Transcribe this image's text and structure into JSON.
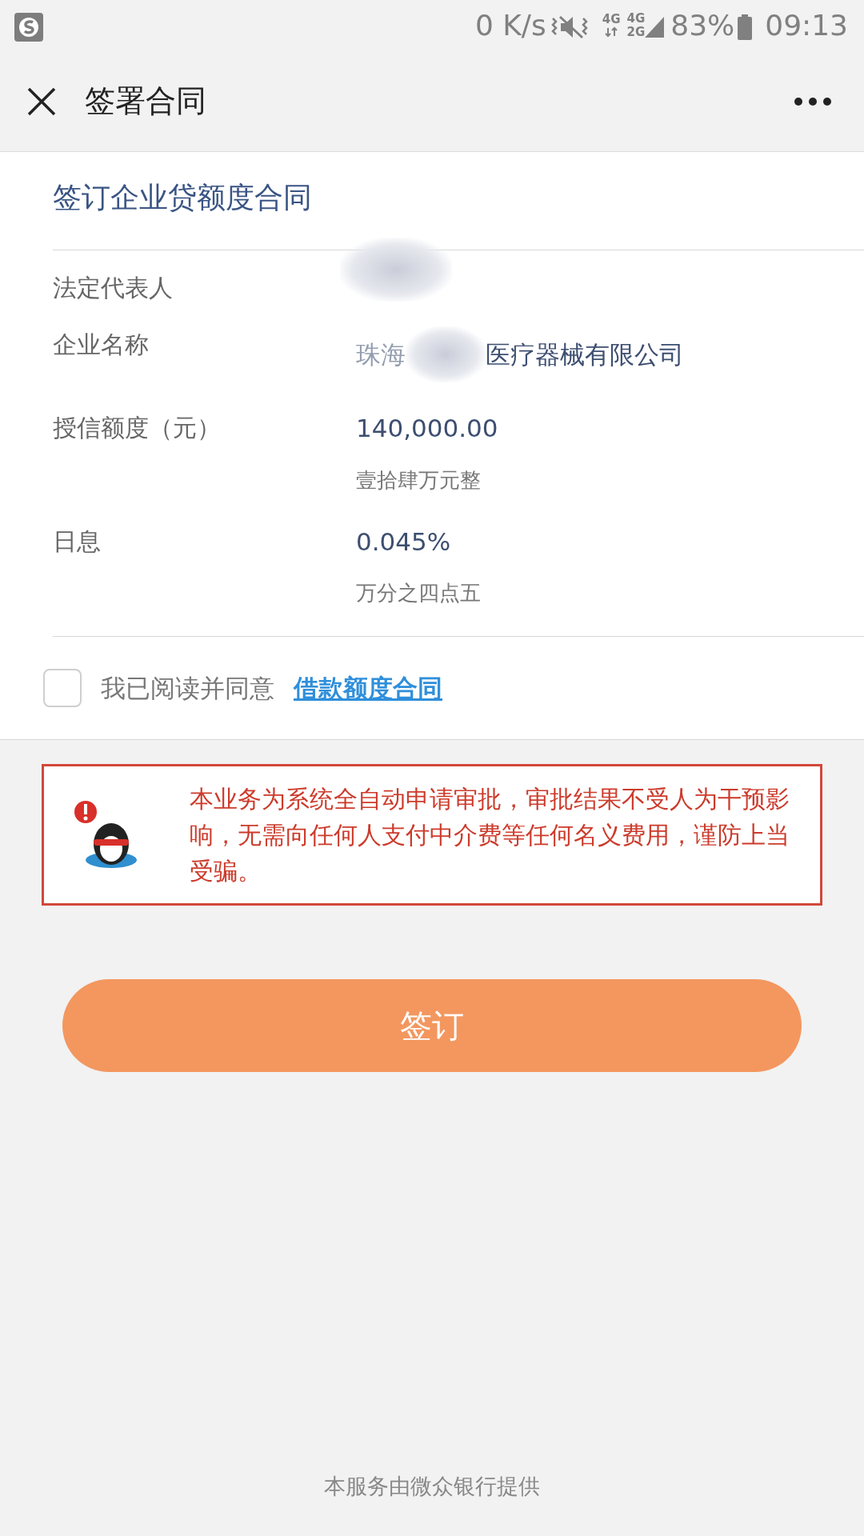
{
  "status_bar": {
    "speed": "0 K/s",
    "network_a": "4G",
    "network_b_top": "4G",
    "network_b_bottom": "2G",
    "battery": "83%",
    "time": "09:13"
  },
  "title_bar": {
    "title": "签署合同"
  },
  "contract": {
    "heading": "签订企业贷额度合同",
    "rows": [
      {
        "kind": "redacted",
        "label": "法定代表人"
      },
      {
        "kind": "partial",
        "label": "企业名称",
        "value_start": "珠海",
        "value_end": "医疗器械有限公司"
      },
      {
        "kind": "amount",
        "label": "授信额度（元）",
        "value": "140,000.00",
        "note": "壹拾肆万元整"
      },
      {
        "kind": "amount",
        "label": "日息",
        "value": "0.045%",
        "note": "万分之四点五"
      }
    ],
    "agreement": {
      "checked": false,
      "text": "我已阅读并同意",
      "link": "借款额度合同"
    }
  },
  "notice": "本业务为系统全自动申请审批，审批结果不受人为干预影响，无需向任何人支付中介费等任何名义费用，谨防上当受骗。",
  "sign_button": "签订",
  "footer": "本服务由微众银行提供"
}
